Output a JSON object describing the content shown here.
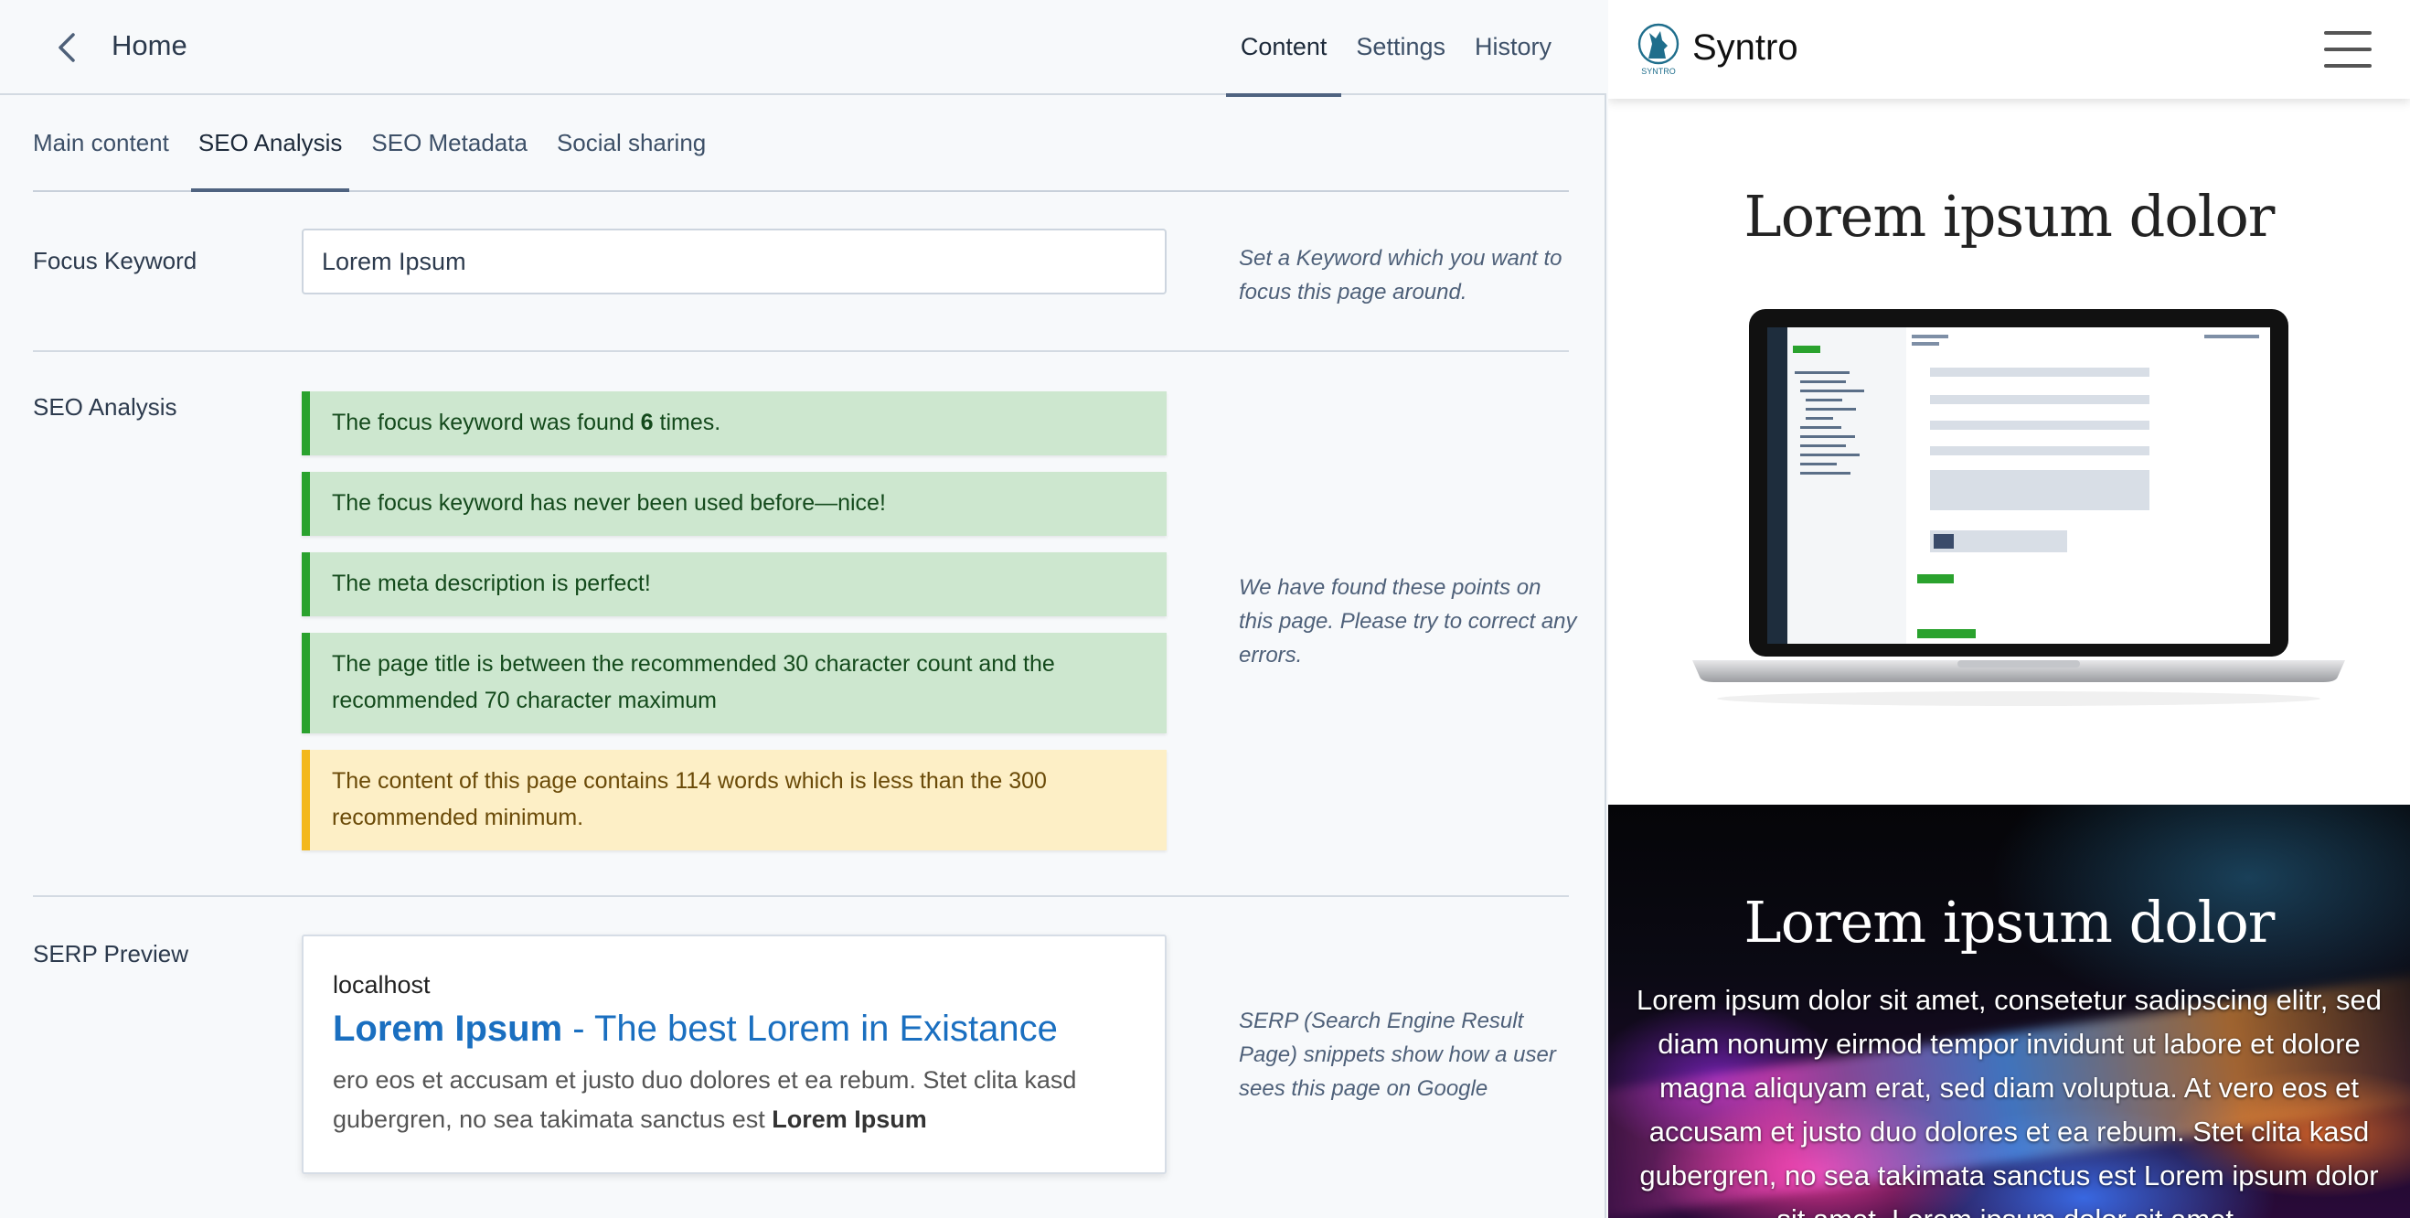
{
  "editor": {
    "back_label": "Home",
    "top_tabs": [
      "Content",
      "Settings",
      "History"
    ],
    "sub_tabs": [
      "Main content",
      "SEO Analysis",
      "SEO Metadata",
      "Social sharing"
    ],
    "focus_keyword": {
      "label": "Focus Keyword",
      "value": "Lorem Ipsum",
      "help": "Set a Keyword which you want to focus this page around."
    },
    "seo_analysis": {
      "label": "SEO Analysis",
      "help": "We have found these points on this page. Please try to correct any errors.",
      "messages": [
        {
          "status": "ok",
          "pre": "The focus keyword was found ",
          "strong": "6",
          "post": " times."
        },
        {
          "status": "ok",
          "pre": "The focus keyword has never been used before—nice!",
          "strong": "",
          "post": ""
        },
        {
          "status": "ok",
          "pre": "The meta description is perfect!",
          "strong": "",
          "post": ""
        },
        {
          "status": "ok",
          "pre": "The page title is between the recommended 30 character count and the recommended 70 character maximum",
          "strong": "",
          "post": ""
        },
        {
          "status": "warn",
          "pre": "The content of this page contains 114 words which is less than the 300 recommended minimum.",
          "strong": "",
          "post": ""
        }
      ],
      "status_colors": {
        "ok": "#2aa22e",
        "warn": "#f3b81c"
      }
    },
    "serp": {
      "label": "SERP Preview",
      "help": "SERP (Search Engine Result Page) snippets show how a user sees this page on Google",
      "url": "localhost",
      "title_strong": "Lorem Ipsum",
      "title_rest": " - The best Lorem in Existance",
      "desc_pre": "ero eos et accusam et justo duo dolores et ea rebum. Stet clita kasd gubergren, no sea takimata sanctus est ",
      "desc_strong": "Lorem Ipsum"
    }
  },
  "preview": {
    "brand": "Syntro",
    "logo_caption": "SYNTRO",
    "heading": "Lorem ipsum dolor",
    "hero_heading": "Lorem ipsum dolor",
    "hero_text": "Lorem ipsum dolor sit amet, consetetur sadipscing elitr, sed diam nonumy eirmod tempor invidunt ut labore et dolore magna aliquyam erat, sed diam voluptua. At vero eos et accusam et justo duo dolores et ea rebum. Stet clita kasd gubergren, no sea takimata sanctus est Lorem ipsum dolor sit amet. Lorem ipsum dolor sit amet."
  },
  "colors": {
    "accent_tab": "#4f6380",
    "serp_link": "#1a6fc0",
    "ok_bg": "#cde7cf",
    "warn_bg": "#fdefc6"
  }
}
